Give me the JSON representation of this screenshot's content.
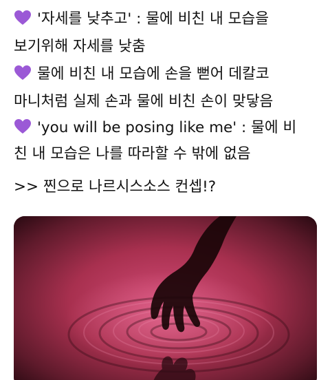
{
  "tweet": {
    "icon": "purple-heart-icon",
    "accent_color": "#9b59d6",
    "line1": "'자세를 낮추고' : 물에 비친 내 모습을",
    "line2": "보기위해 자세를 낮춤",
    "line3": "물에 비친 내 모습에 손을 뻗어 데칼코",
    "line4": "마니처럼 실제 손과 물에 비친 손이 맞닿음",
    "line5": "'you will be posing like me' : 물에 비",
    "line6": "친 내 모습은 나를 따라할 수 밖에 없음",
    "line7": ">> 찐으로 나르시스소스 컨셉!?"
  },
  "media": {
    "description_colors": [
      "#c8436d",
      "#6d1f33",
      "#1a0508"
    ]
  }
}
